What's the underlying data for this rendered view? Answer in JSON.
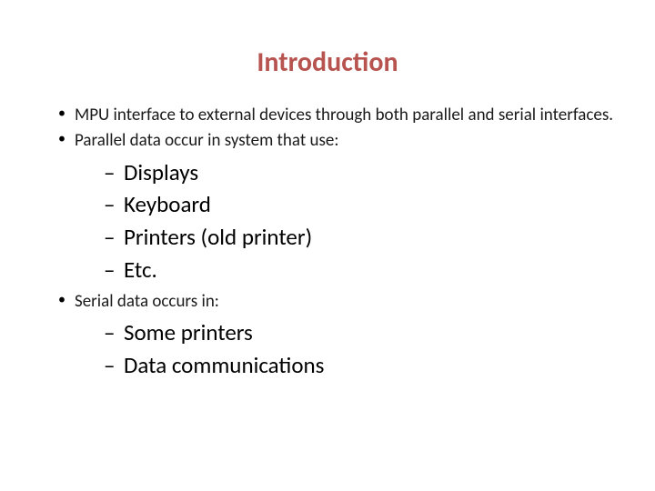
{
  "title": "Introduction",
  "bullets": {
    "b1": "MPU interface to external devices through both parallel and serial interfaces.",
    "b2": "Parallel data occur in system that use:",
    "b2_items": {
      "i1": "Displays",
      "i2": "Keyboard",
      "i3": "Printers (old printer)",
      "i4": "Etc."
    },
    "b3": "Serial data occurs in:",
    "b3_items": {
      "i1": "Some printers",
      "i2": "Data communications"
    }
  }
}
